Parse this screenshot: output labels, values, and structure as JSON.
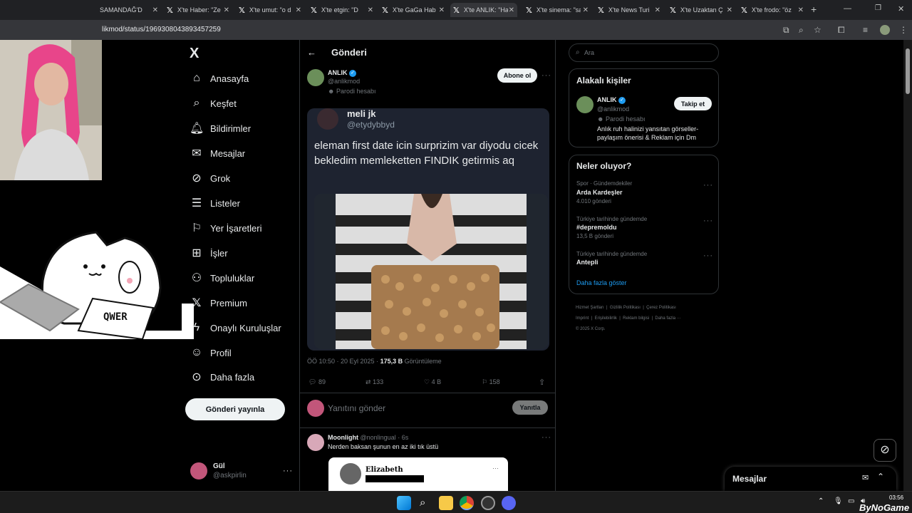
{
  "tabs": [
    {
      "title": "SAMANDAĞ'D"
    },
    {
      "title": "X'te Haber: \"Ze"
    },
    {
      "title": "X'te umut: \"o d"
    },
    {
      "title": "X'te etgin: \"D"
    },
    {
      "title": "X'te GaGa Hab"
    },
    {
      "title": "X'te ANLIK: \"Ha"
    },
    {
      "title": "X'te sinema: \"sa"
    },
    {
      "title": "X'te News Turi"
    },
    {
      "title": "X'te Uzaktan Ç"
    },
    {
      "title": "X'te frodo: \"öz"
    }
  ],
  "url": "likmod/status/1969308043893457259",
  "nav": {
    "logo": "X",
    "items": [
      "Anasayfa",
      "Keşfet",
      "Bildirimler",
      "Mesajlar",
      "Grok",
      "Listeler",
      "Yer İşaretleri",
      "İşler",
      "Topluluklar",
      "Premium",
      "Onaylı Kuruluşlar",
      "Profil",
      "Daha fazla"
    ],
    "post_button": "Gönderi yayınla"
  },
  "account": {
    "name": "Gül",
    "handle": "@askpirlin"
  },
  "header": {
    "title": "Gönderi"
  },
  "tweet": {
    "author": "ANLIK",
    "handle": "@anlikmod",
    "badge": "Parodi hesabı",
    "follow": "Abone ol",
    "quoted_name": "meli jk",
    "quoted_handle": "@etydybbyd",
    "text": "eleman first date icin surprizim var diyodu cicek bekledim memleketten FINDIK getirmis aq",
    "time": "ÖÖ 10:50 · 20 Eyl 2025 ·",
    "views": "175,3 B",
    "views_label": "Görüntüleme",
    "stats": {
      "replies": "89",
      "reposts": "133",
      "likes": "4 B",
      "bookmarks": "158"
    }
  },
  "reply_box": {
    "placeholder": "Yanıtını gönder",
    "button": "Yanıtla"
  },
  "reply": {
    "name": "Moonlight",
    "handle": "@nonlingual",
    "time": "· 6s",
    "text": "Nerden baksan şunun en az iki tık üstü",
    "embed_name": "Elizabeth"
  },
  "search": {
    "placeholder": "Ara"
  },
  "related": {
    "title": "Alakalı kişiler",
    "name": "ANLIK",
    "handle": "@anlikmod",
    "badge": "Parodi hesabı",
    "bio": "Anlık ruh halinizi yansıtan görseller- paylaşım önerisi & Reklam için Dm",
    "follow": "Takip et"
  },
  "trends": {
    "title": "Neler oluyor?",
    "items": [
      {
        "context": "Spor · Gündemdekiler",
        "name": "Arda Kardeşler",
        "count": "4.010 gönderi"
      },
      {
        "context": "Türkiye tarihinde gündemde",
        "name": "#depremoldu",
        "count": "13,5 B gönderi"
      },
      {
        "context": "Türkiye tarihinde gündemde",
        "name": "Antepli",
        "count": ""
      }
    ],
    "more": "Daha fazla göster"
  },
  "footer": {
    "links": [
      "Hizmet Şartları",
      "Gizlilik Politikası",
      "Çerez Politikası",
      "Imprint",
      "Erişilebilirlik",
      "Reklam bilgisi",
      "Daha fazla ···"
    ],
    "copyright": "© 2025 X Corp."
  },
  "messages": {
    "title": "Mesajlar"
  },
  "taskbar": {
    "time": "03:56",
    "watermark": "ByNoGame"
  },
  "overlay": {
    "keyboard_letters": "QWER"
  }
}
